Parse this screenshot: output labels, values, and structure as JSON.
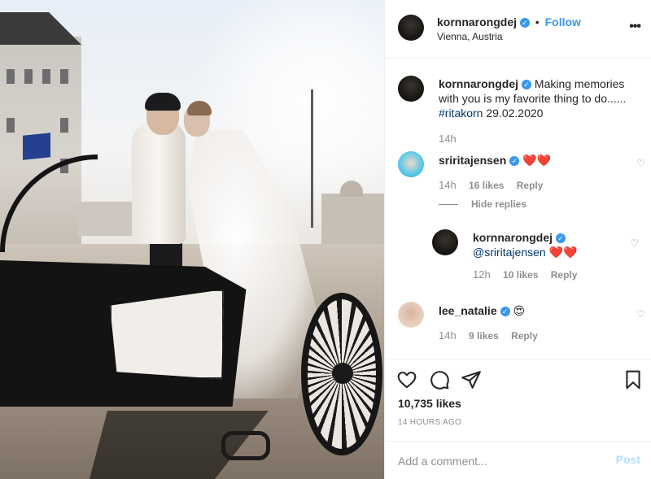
{
  "post": {
    "username": "kornnarongdej",
    "follow_label": "Follow",
    "location": "Vienna, Austria",
    "more_label": "•••"
  },
  "caption": {
    "username": "kornnarongdej",
    "text": "Making memories with you is my favorite thing to do......",
    "hashtag": "#ritakorn",
    "date": "29.02.2020",
    "time": "14h"
  },
  "comments": [
    {
      "username": "sriritajensen",
      "text": "❤️❤️",
      "time": "14h",
      "likes": "16 likes",
      "reply_label": "Reply"
    },
    {
      "username": "lee_natalie",
      "text": "😍",
      "time": "14h",
      "likes": "9 likes",
      "reply_label": "Reply"
    }
  ],
  "hide_replies_label": "Hide replies",
  "reply": {
    "username": "kornnarongdej",
    "mention": "@sriritajensen",
    "text": "❤️❤️",
    "time": "12h",
    "likes": "10 likes",
    "reply_label": "Reply"
  },
  "actions": {
    "likes_count": "10,735 likes",
    "posted_time": "14 HOURS AGO"
  },
  "add_comment": {
    "placeholder": "Add a comment...",
    "post_label": "Post"
  },
  "colors": {
    "link_blue": "#3897f0",
    "post_button_disabled": "#b2dffc",
    "verified_badge": "#3897f0"
  }
}
